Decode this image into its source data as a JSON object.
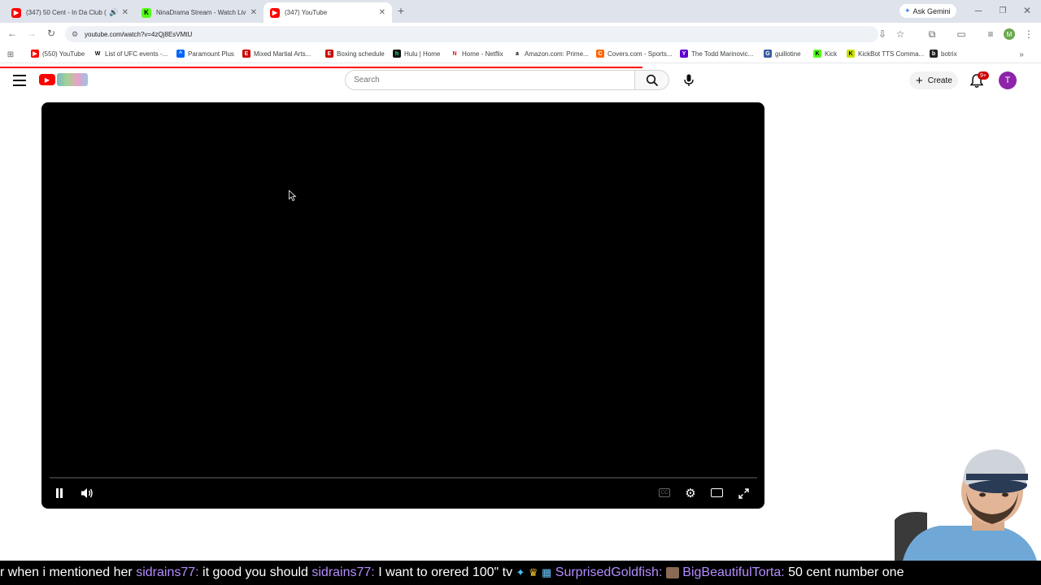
{
  "browser": {
    "tabs": [
      {
        "title": "(347) 50 Cent - In Da Club (",
        "favicon": "youtube-icon",
        "active": false
      },
      {
        "title": "NinaDrama Stream - Watch Liv",
        "favicon": "kick-icon",
        "active": false
      },
      {
        "title": "(347) YouTube",
        "favicon": "youtube-icon",
        "active": true
      }
    ],
    "ask_gemini": "Ask Gemini",
    "url": "youtube.com/watch?v=4zQj8EsVMtU",
    "bookmarks": [
      "(550) YouTube",
      "List of UFC events -...",
      "Paramount Plus",
      "Mixed Martial Arts...",
      "Boxing schedule",
      "Hulu | Home",
      "Home - Netflix",
      "Amazon.com: Prime...",
      "Covers.com - Sports...",
      "The Todd Marinovic...",
      "guillotine",
      "Kick",
      "KickBot TTS Comma...",
      "botrix"
    ],
    "profile_initial": "M"
  },
  "youtube": {
    "search_placeholder": "Search",
    "create_label": "Create",
    "notification_badge": "9+",
    "avatar_initial": "T",
    "accent_color": "#ff0000"
  },
  "chat": {
    "messages": [
      {
        "user": "",
        "text": "r when i mentioned her"
      },
      {
        "user": "sidrains77:",
        "text": "it good you should"
      },
      {
        "user": "sidrains77:",
        "text": "I want to orered 100\" tv"
      },
      {
        "user": "SurprisedGoldfish:",
        "text": ""
      },
      {
        "user": "BigBeautifulTorta:",
        "text": "50 cent number one"
      }
    ]
  }
}
